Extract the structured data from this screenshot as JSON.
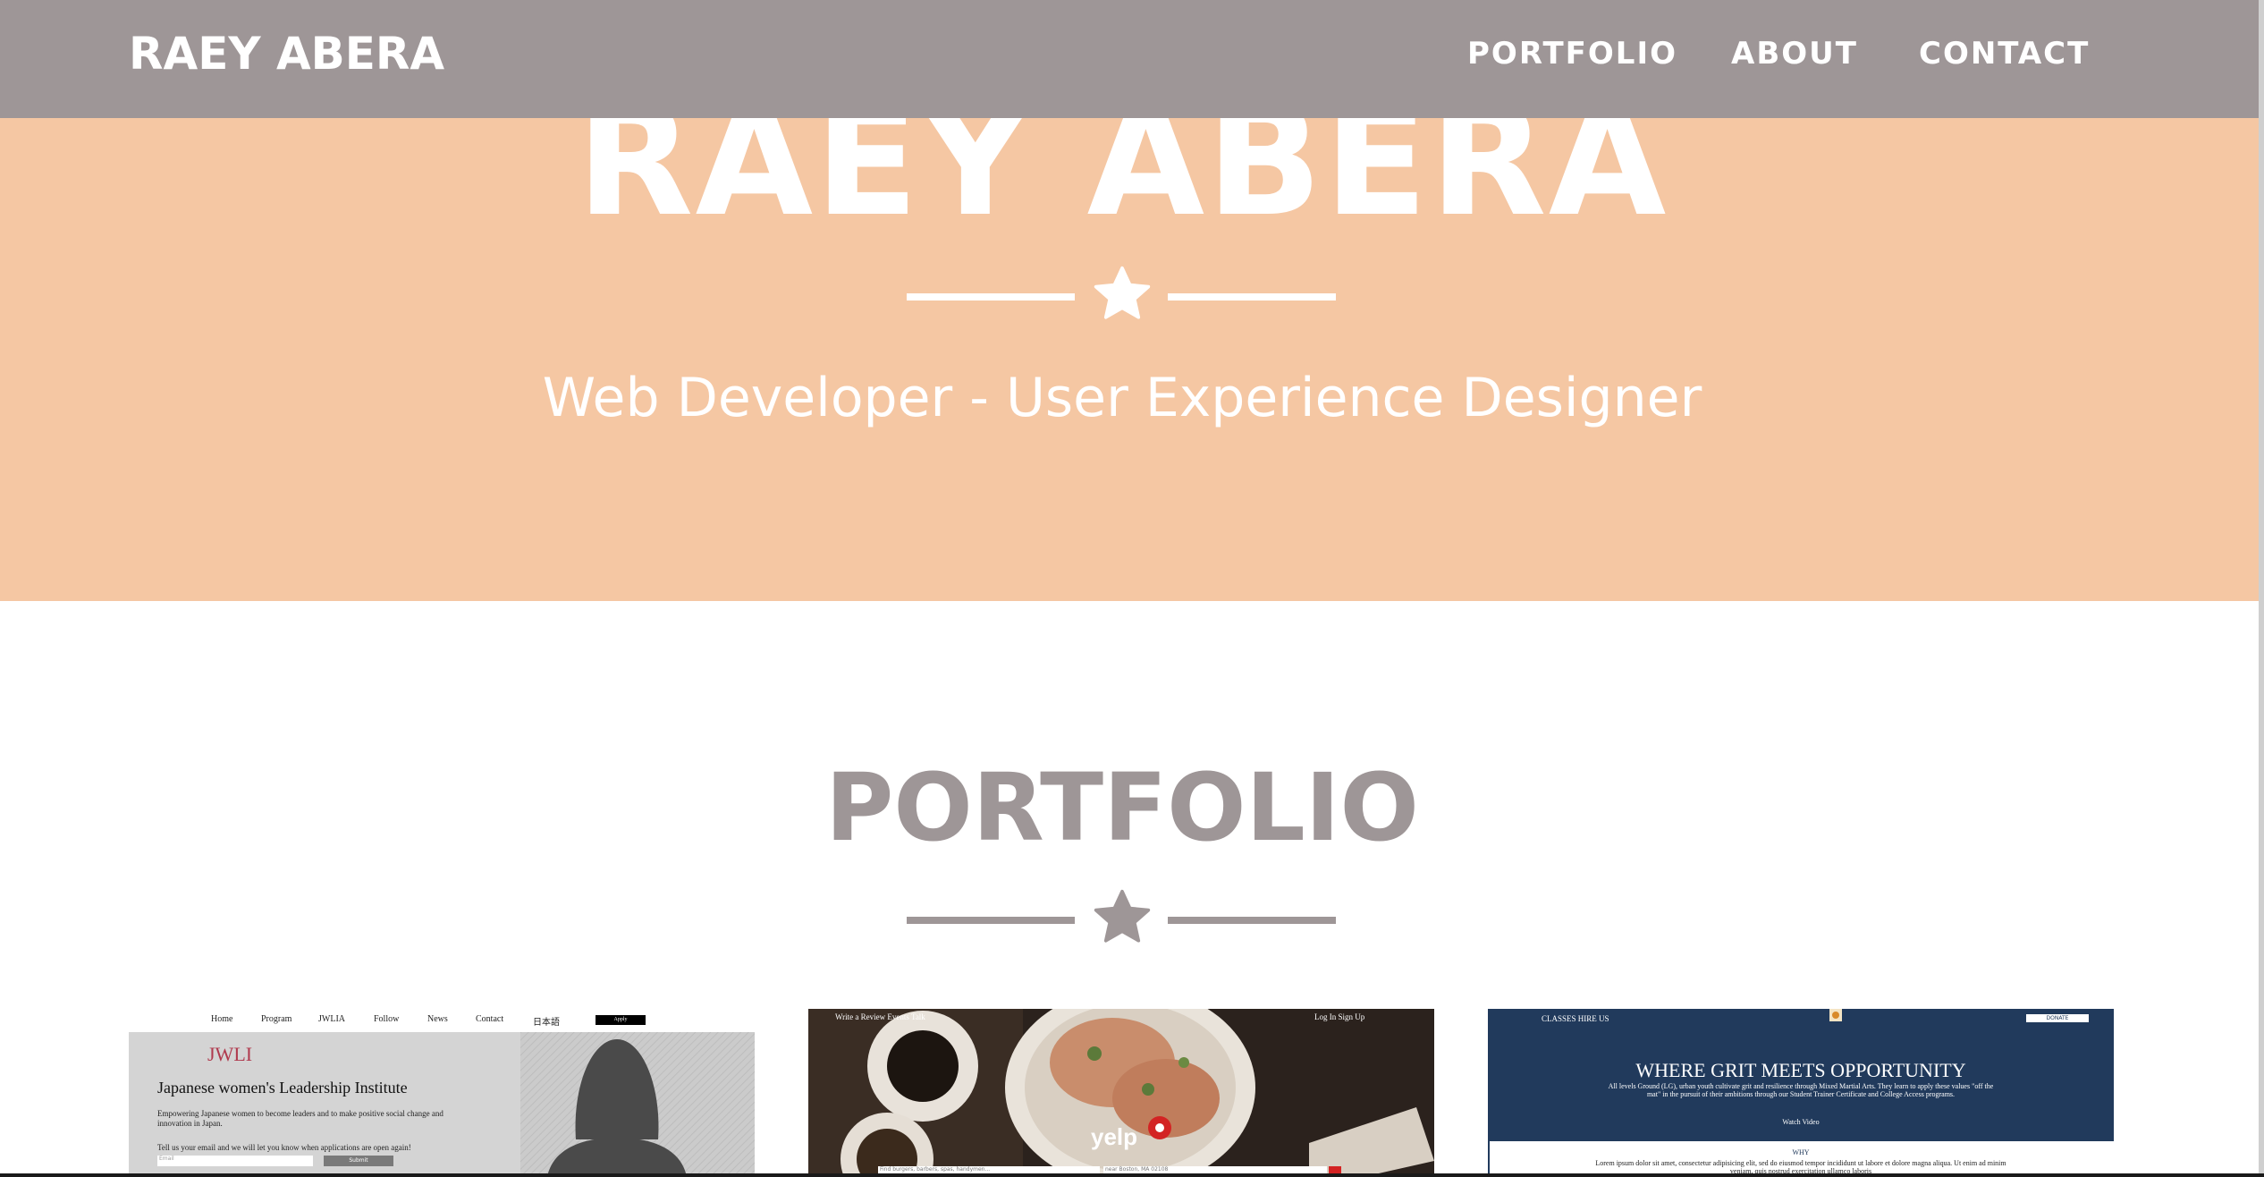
{
  "colors": {
    "navbar_bg": "#9e9697",
    "hero_bg": "#f5c7a3",
    "hero_text": "#ffffff",
    "portfolio_heading": "#9e9697",
    "page_bg": "#ffffff"
  },
  "navbar": {
    "brand": "RAEY ABERA",
    "links": [
      "PORTFOLIO",
      "ABOUT",
      "CONTACT"
    ]
  },
  "hero": {
    "name": "RAEY ABERA",
    "divider_icon": "star-icon",
    "subtitle": "Web Developer - User Experience Designer"
  },
  "portfolio": {
    "heading": "PORTFOLIO",
    "divider_icon": "star-icon",
    "items": [
      {
        "name": "JWLI",
        "nav": [
          "Home",
          "Program",
          "JWLIA",
          "Follow",
          "News",
          "Contact",
          "日本語"
        ],
        "apply": "Apply",
        "logo": "JWLI",
        "title": "Japanese women's Leadership Institute",
        "text": "Empowering Japanese women to become leaders and to make positive social change and innovation in Japan.",
        "text2": "Tell us your email and we will let you know when applications are open again!",
        "input_placeholder": "Email",
        "submit": "Submit"
      },
      {
        "name": "Yelp",
        "nav_left": "Write a Review    Events    Talk",
        "nav_right": "Log In    Sign Up",
        "logo": "yelp",
        "search1": "Find burgers, barbers, spas, handymen...",
        "search2": "near Boston, MA 02108"
      },
      {
        "name": "Grit",
        "nav": "CLASSES    HIRE US",
        "donate": "DONATE",
        "title": "WHERE GRIT MEETS OPPORTUNITY",
        "text": "All levels Ground (LG), urban youth cultivate grit and resilience through Mixed Martial Arts. They learn to apply these values \"off the mat\" in the pursuit of their ambitions through our Student Trainer Certificate and College Access programs.",
        "video": "Watch Video",
        "why": "WHY",
        "lorem": "Lorem ipsum dolor sit amet, consectetur adipisicing elit, sed do eiusmod tempor incididunt ut labore et dolore magna aliqua. Ut enim ad minim veniam, quis nostrud exercitation ullamco laboris"
      }
    ]
  }
}
